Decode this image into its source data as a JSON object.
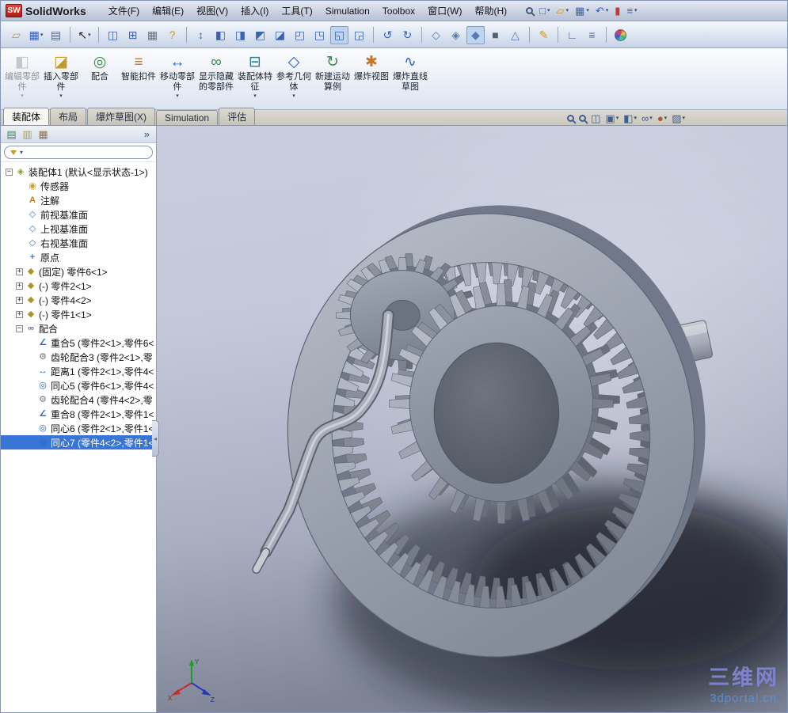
{
  "ui": {
    "caret": "▾"
  },
  "titlebar": {
    "logo_text": "SW",
    "app_name": "SolidWorks",
    "menus": [
      "文件(F)",
      "编辑(E)",
      "视图(V)",
      "插入(I)",
      "工具(T)",
      "Simulation",
      "Toolbox",
      "窗口(W)",
      "帮助(H)"
    ],
    "quick_icons": [
      {
        "name": "search-icon",
        "type": "mag"
      },
      {
        "name": "new-document-icon",
        "glyph": "□",
        "color": "#3a62b0",
        "dropdown": true
      },
      {
        "name": "open-icon",
        "glyph": "▱",
        "color": "#c8982a",
        "dropdown": true
      },
      {
        "name": "save-icon",
        "glyph": "▦",
        "color": "#3a62b0",
        "dropdown": true
      },
      {
        "name": "undo-icon",
        "glyph": "↶",
        "color": "#2a62c9",
        "dropdown": true
      },
      {
        "name": "rebuild-icon",
        "glyph": "▮",
        "color": "#c0392b"
      },
      {
        "name": "options-list-icon",
        "glyph": "≡",
        "color": "#3a62b0",
        "dropdown": true
      }
    ]
  },
  "toolbar": {
    "items": [
      {
        "name": "open-document-icon",
        "glyph": "▱",
        "color": "#c8982a"
      },
      {
        "name": "save-document-icon",
        "glyph": "▦",
        "color": "#3a62b0",
        "dropdown": true
      },
      {
        "name": "print-icon",
        "glyph": "▤",
        "color": "#5a6a85"
      },
      {
        "type": "sep"
      },
      {
        "name": "select-arrow-icon",
        "glyph": "↖",
        "color": "#222222",
        "dropdown": true
      },
      {
        "type": "sep"
      },
      {
        "name": "split-view-icon",
        "glyph": "◫",
        "color": "#3a62b0"
      },
      {
        "name": "quad-view-icon",
        "glyph": "⊞",
        "color": "#3a62b0"
      },
      {
        "name": "grid-icon",
        "glyph": "▦",
        "color": "#6a7280"
      },
      {
        "name": "help-icon",
        "glyph": "?",
        "color": "#c8982a"
      },
      {
        "type": "sep"
      },
      {
        "name": "pan-updown-icon",
        "glyph": "↕",
        "color": "#2a62c9"
      },
      {
        "name": "view-front-icon",
        "glyph": "◧",
        "color": "#3a62b0"
      },
      {
        "name": "view-back-icon",
        "glyph": "◨",
        "color": "#3a62b0"
      },
      {
        "name": "view-left-icon",
        "glyph": "◩",
        "color": "#3a62b0"
      },
      {
        "name": "view-right-icon",
        "glyph": "◪",
        "color": "#3a62b0"
      },
      {
        "name": "view-top-icon",
        "glyph": "◰",
        "color": "#3a62b0"
      },
      {
        "name": "view-bottom-icon",
        "glyph": "◳",
        "color": "#3a62b0"
      },
      {
        "name": "view-isometric-icon",
        "glyph": "◱",
        "color": "#3a62b0",
        "pressed": true
      },
      {
        "name": "view-dimetric-icon",
        "glyph": "◲",
        "color": "#3a62b0"
      },
      {
        "type": "sep"
      },
      {
        "name": "previous-view-icon",
        "glyph": "↺",
        "color": "#2a62c9"
      },
      {
        "name": "redraw-icon",
        "glyph": "↻",
        "color": "#2a62c9"
      },
      {
        "type": "sep"
      },
      {
        "name": "wireframe-icon",
        "glyph": "◇",
        "color": "#5a7ab0"
      },
      {
        "name": "hidden-lines-icon",
        "glyph": "◈",
        "color": "#5a7ab0"
      },
      {
        "name": "shaded-icon",
        "glyph": "◆",
        "color": "#5a7ab0",
        "pressed": true
      },
      {
        "name": "shadows-icon",
        "glyph": "■",
        "color": "#55606f"
      },
      {
        "name": "perspective-icon",
        "glyph": "△",
        "color": "#5a7ab0"
      },
      {
        "type": "sep"
      },
      {
        "name": "appearance-pencil-icon",
        "glyph": "✎",
        "color": "#c8982a"
      },
      {
        "type": "sep"
      },
      {
        "name": "measure-icon",
        "glyph": "∟",
        "color": "#5a6a85"
      },
      {
        "name": "annotations-toolbar-icon",
        "glyph": "≡",
        "color": "#5a6a85"
      },
      {
        "type": "sep"
      },
      {
        "name": "color-wheel-icon",
        "type": "wheel"
      }
    ]
  },
  "ribbon": {
    "buttons": [
      {
        "name": "edit-component-button",
        "label": "编辑零部件",
        "glyph": "◧",
        "color": "#8a909c",
        "enabled": false,
        "dropdown": true
      },
      {
        "name": "insert-component-button",
        "label": "插入零部件",
        "glyph": "◪",
        "color": "#c49a2a",
        "enabled": true,
        "dropdown": true
      },
      {
        "name": "mate-button",
        "label": "配合",
        "glyph": "◎",
        "color": "#3a8f4e",
        "enabled": true,
        "dropdown": false
      },
      {
        "name": "smart-fasteners-button",
        "label": "智能扣件",
        "glyph": "≡",
        "color": "#c4762a",
        "enabled": true,
        "dropdown": false
      },
      {
        "name": "move-component-button",
        "label": "移动零部件",
        "glyph": "↔",
        "color": "#2a62c9",
        "enabled": true,
        "dropdown": true
      },
      {
        "name": "show-hidden-components-button",
        "label": "显示隐藏的零部件",
        "glyph": "∞",
        "color": "#3a8f4e",
        "enabled": true,
        "dropdown": false
      },
      {
        "name": "assembly-features-button",
        "label": "装配体特征",
        "glyph": "⊟",
        "color": "#2a7f8f",
        "enabled": true,
        "dropdown": true
      },
      {
        "name": "reference-geometry-button",
        "label": "参考几何体",
        "glyph": "◇",
        "color": "#2a62c9",
        "enabled": true,
        "dropdown": true
      },
      {
        "name": "new-motion-study-button",
        "label": "新建运动算例",
        "glyph": "↻",
        "color": "#3a8f4e",
        "enabled": true,
        "dropdown": false
      },
      {
        "name": "exploded-view-button",
        "label": "爆炸视图",
        "glyph": "✱",
        "color": "#c4762a",
        "enabled": true,
        "dropdown": false
      },
      {
        "name": "explode-line-sketch-button",
        "label": "爆炸直线草图",
        "glyph": "∿",
        "color": "#2a62c9",
        "enabled": true,
        "dropdown": false
      }
    ]
  },
  "tabs": [
    {
      "name": "tab-assembly",
      "label": "装配体",
      "active": true
    },
    {
      "name": "tab-layout",
      "label": "布局",
      "active": false
    },
    {
      "name": "tab-exploded-sketch",
      "label": "爆炸草图(X)",
      "active": false
    },
    {
      "name": "tab-simulation",
      "label": "Simulation",
      "active": false
    },
    {
      "name": "tab-evaluate",
      "label": "评估",
      "active": false
    }
  ],
  "headsup": [
    {
      "name": "zoom-fit-icon",
      "type": "mag"
    },
    {
      "name": "zoom-area-icon",
      "type": "mag"
    },
    {
      "name": "section-view-icon",
      "glyph": "◫",
      "color": "#3f5f8f"
    },
    {
      "name": "view-orientation-icon",
      "glyph": "▣",
      "color": "#3f5f8f",
      "dropdown": true
    },
    {
      "name": "display-style-icon",
      "glyph": "◧",
      "color": "#3f5f8f",
      "dropdown": true
    },
    {
      "name": "hide-show-items-icon",
      "glyph": "∞",
      "color": "#3f5f8f",
      "dropdown": true
    },
    {
      "name": "edit-appearance-icon",
      "glyph": "●",
      "color": "#b3583a",
      "dropdown": true
    },
    {
      "name": "apply-scene-icon",
      "glyph": "▨",
      "color": "#3f5f8f",
      "dropdown": true
    }
  ],
  "panel": {
    "collapse_glyph": "»",
    "splitter_glyph": "◂",
    "header_icons": [
      {
        "name": "feature-manager-tab-icon",
        "glyph": "▤",
        "color": "#2f8f4e"
      },
      {
        "name": "property-manager-tab-icon",
        "glyph": "▥",
        "color": "#c49a2a"
      },
      {
        "name": "configuration-manager-tab-icon",
        "glyph": "▦",
        "color": "#b06a2a"
      }
    ],
    "tree_icons": {
      "assembly": {
        "glyph": "◈",
        "color": "#8a9a3a"
      },
      "sensors": {
        "glyph": "◉",
        "color": "#c9a227"
      },
      "annotations": {
        "glyph": "A",
        "color": "#cc7a00"
      },
      "plane": {
        "glyph": "◇",
        "color": "#3a7abf"
      },
      "origin": {
        "glyph": "+",
        "color": "#3a7abf"
      },
      "part": {
        "glyph": "◆",
        "color": "#b0922c"
      },
      "mates": {
        "glyph": "∞",
        "color": "#6e7584"
      },
      "coincident": {
        "glyph": "∠",
        "color": "#2a62c9"
      },
      "gear-mate": {
        "glyph": "⚙",
        "color": "#6e7584"
      },
      "distance": {
        "glyph": "↔",
        "color": "#2a62c9"
      },
      "concentric": {
        "glyph": "◎",
        "color": "#2a62c9"
      }
    },
    "tree": [
      {
        "level": 0,
        "expand": "-",
        "icon": "assembly",
        "label": "装配体1 (默认<显示状态-1>)",
        "name": "tree-item-assembly1"
      },
      {
        "level": 1,
        "icon": "sensors",
        "label": "传感器",
        "name": "tree-item-sensors"
      },
      {
        "level": 1,
        "icon": "annotations",
        "label": "注解",
        "name": "tree-item-annotations"
      },
      {
        "level": 1,
        "icon": "plane",
        "label": "前视基准面",
        "name": "tree-item-front-plane"
      },
      {
        "level": 1,
        "icon": "plane",
        "label": "上视基准面",
        "name": "tree-item-top-plane"
      },
      {
        "level": 1,
        "icon": "plane",
        "label": "右视基准面",
        "name": "tree-item-right-plane"
      },
      {
        "level": 1,
        "icon": "origin",
        "label": "原点",
        "name": "tree-item-origin"
      },
      {
        "level": 1,
        "expand": "+",
        "icon": "part",
        "label": "(固定) 零件6<1>",
        "name": "tree-item-part6"
      },
      {
        "level": 1,
        "expand": "+",
        "icon": "part",
        "label": "(-) 零件2<1>",
        "name": "tree-item-part2"
      },
      {
        "level": 1,
        "expand": "+",
        "icon": "part",
        "label": "(-) 零件4<2>",
        "name": "tree-item-part4"
      },
      {
        "level": 1,
        "expand": "+",
        "icon": "part",
        "label": "(-) 零件1<1>",
        "name": "tree-item-part1"
      },
      {
        "level": 1,
        "expand": "-",
        "icon": "mates",
        "label": "配合",
        "name": "tree-item-mates-folder"
      },
      {
        "level": 2,
        "icon": "coincident",
        "label": "重合5 (零件2<1>,零件6<",
        "name": "tree-item-mate-coincident5"
      },
      {
        "level": 2,
        "icon": "gear-mate",
        "label": "齿轮配合3 (零件2<1>,零",
        "name": "tree-item-mate-gear3"
      },
      {
        "level": 2,
        "icon": "distance",
        "label": "距离1 (零件2<1>,零件4<",
        "name": "tree-item-mate-distance1"
      },
      {
        "level": 2,
        "icon": "concentric",
        "label": "同心5 (零件6<1>,零件4<",
        "name": "tree-item-mate-concentric5"
      },
      {
        "level": 2,
        "icon": "gear-mate",
        "label": "齿轮配合4 (零件4<2>,零",
        "name": "tree-item-mate-gear4"
      },
      {
        "level": 2,
        "icon": "coincident",
        "label": "重合8 (零件2<1>,零件1<",
        "name": "tree-item-mate-coincident8"
      },
      {
        "level": 2,
        "icon": "concentric",
        "label": "同心6 (零件2<1>,零件1<",
        "name": "tree-item-mate-concentric6"
      },
      {
        "level": 2,
        "icon": "concentric",
        "label": "同心7 (零件4<2>,零件1<",
        "name": "tree-item-mate-concentric7",
        "selected": true
      }
    ]
  },
  "viewport": {
    "watermark_line1": "三维网",
    "watermark_line2": "3dportal.cn",
    "triad": {
      "x_label": "X",
      "y_label": "Y",
      "z_label": "Z"
    }
  }
}
